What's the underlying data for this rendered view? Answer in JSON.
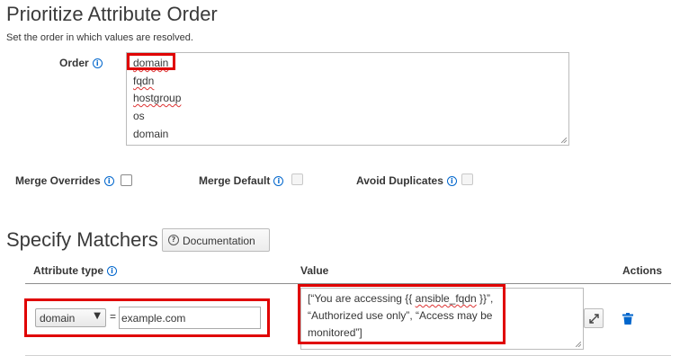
{
  "prioritize": {
    "title": "Prioritize Attribute Order",
    "description": "Set the order in which values are resolved.",
    "order_label": "Order",
    "order_items": [
      "domain",
      "fqdn",
      "hostgroup",
      "os",
      "domain"
    ]
  },
  "options": {
    "merge_overrides": "Merge Overrides",
    "merge_default": "Merge Default",
    "avoid_duplicates": "Avoid Duplicates"
  },
  "matchers": {
    "title": "Specify Matchers",
    "documentation_button": "Documentation",
    "columns": {
      "attribute_type": "Attribute type",
      "value": "Value",
      "actions": "Actions"
    },
    "row": {
      "attribute": "domain",
      "equals": "=",
      "match_value": "example.com",
      "value_line1_pre": "[“You are accessing {{ ",
      "value_line1_word": "ansible_fqdn",
      "value_line1_post": " }}”,",
      "value_line2": "“Authorized use only”, “Access may be",
      "value_line3": "monitored”]"
    }
  },
  "icons": {
    "info": "info-circle-icon",
    "help": "question-circle-icon",
    "expand": "expand-icon",
    "delete": "trash-icon",
    "dropdown": "caret-down-icon"
  },
  "colors": {
    "highlight": "#e00000",
    "accent": "#0066cc"
  }
}
